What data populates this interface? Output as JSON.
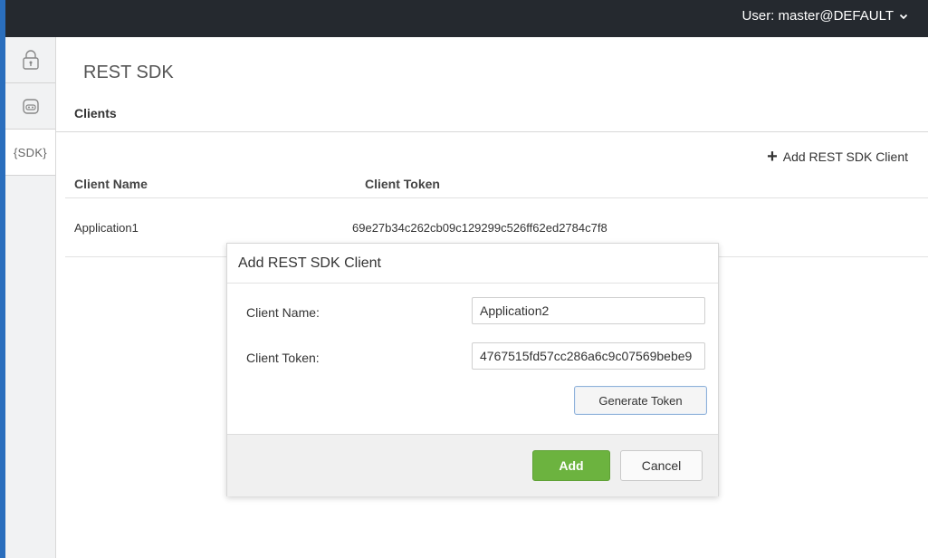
{
  "header": {
    "user_label": "User: master@DEFAULT",
    "user_menu_icon": "chevron-down-icon"
  },
  "sidebar": {
    "items": [
      {
        "icon": "lock-icon",
        "label": ""
      },
      {
        "icon": "robot-icon",
        "label": ""
      },
      {
        "icon": "sdk-icon",
        "label": "{SDK}"
      }
    ]
  },
  "page": {
    "title": "REST SDK",
    "section_title": "Clients",
    "add_client_label": "Add REST SDK Client",
    "add_client_icon": "plus-icon"
  },
  "table": {
    "columns": [
      "Client Name",
      "Client Token"
    ],
    "rows": [
      {
        "client_name": "Application1",
        "client_token": "69e27b34c262cb09c129299c526ff62ed2784c7f8"
      }
    ]
  },
  "dialog": {
    "title": "Add REST SDK Client",
    "client_name_label": "Client Name:",
    "client_name_value": "Application2",
    "client_token_label": "Client Token:",
    "client_token_value": "4767515fd57cc286a6c9c07569bebe9",
    "generate_label": "Generate Token",
    "add_label": "Add",
    "cancel_label": "Cancel"
  },
  "colors": {
    "topbar": "#25292f",
    "left_accent": "#2a6ebd",
    "add_button": "#6cb33f"
  }
}
